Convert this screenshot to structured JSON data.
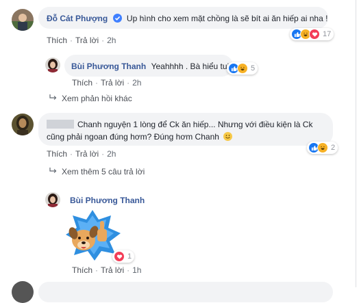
{
  "comments": [
    {
      "author": "Đỗ Cát Phượng",
      "text": "Up hình cho xem mặt chồng là sẽ bít ai ăn hiếp ai nha !",
      "like_label": "Thích",
      "reply_label": "Trả lời",
      "time": "2h",
      "reaction_count": "17",
      "reactions": [
        "like-icon",
        "haha-icon",
        "love-icon"
      ],
      "verified_icon": "verified-badge-icon"
    }
  ],
  "reply1": {
    "author": "Bùi Phương Thanh",
    "text": "Yeahhhh . Bà hiểu tui",
    "like_label": "Thích",
    "reply_label": "Trả lời",
    "time": "2h",
    "reaction_count": "5",
    "reactions": [
      "like-icon",
      "haha-icon"
    ]
  },
  "more_replies_1": "Xem phản hồi khác",
  "comment2": {
    "text_line1": "Chanh nguyện 1 lòng để Ck ăn hiếp... Nhưng với điều kiện là Ck",
    "text_line2": "cũng phải ngoan đúng hơm? Đúng hơm Chanh",
    "like_label": "Thích",
    "reply_label": "Trả lời",
    "time": "2h",
    "reaction_count": "2",
    "reactions": [
      "like-icon",
      "haha-icon"
    ]
  },
  "more_replies_2": "Xem thêm 5 câu trả lời",
  "reply2": {
    "author": "Bùi Phương Thanh",
    "like_label": "Thích",
    "reply_label": "Trả lời",
    "time": "1h",
    "reaction_count": "1",
    "reactions": [
      "love-icon"
    ],
    "sticker": "thumbs-up-dog-sticker"
  },
  "colors": {
    "name": "#385898",
    "bubble": "#f2f3f5",
    "like": "#1877f2",
    "haha": "#f7b125",
    "love": "#f33e58"
  }
}
